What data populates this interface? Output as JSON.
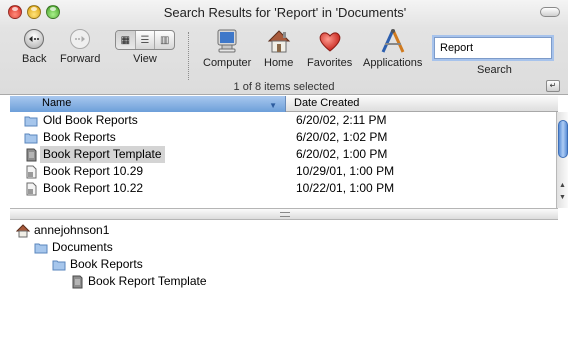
{
  "window": {
    "title": "Search Results for 'Report' in 'Documents'"
  },
  "toolbar": {
    "back_label": "Back",
    "forward_label": "Forward",
    "view_label": "View",
    "computer_label": "Computer",
    "home_label": "Home",
    "favorites_label": "Favorites",
    "applications_label": "Applications",
    "search_label": "Search",
    "search_value": "Report"
  },
  "status": {
    "text": "1 of 8 items selected"
  },
  "list": {
    "columns": {
      "name": "Name",
      "date": "Date Created"
    },
    "rows": [
      {
        "name": "Old Book Reports",
        "date": "6/20/02, 2:11 PM",
        "icon": "folder-icon",
        "selected": false
      },
      {
        "name": "Book Reports",
        "date": "6/20/02, 1:02 PM",
        "icon": "folder-icon",
        "selected": false
      },
      {
        "name": "Book Report Template",
        "date": "6/20/02, 1:00 PM",
        "icon": "stationery-icon",
        "selected": true
      },
      {
        "name": "Book Report 10.29",
        "date": "10/29/01, 1:00 PM",
        "icon": "document-icon",
        "selected": false
      },
      {
        "name": "Book Report 10.22",
        "date": "10/22/01, 1:00 PM",
        "icon": "document-icon",
        "selected": false
      }
    ]
  },
  "path": {
    "items": [
      {
        "label": "annejohnson1",
        "icon": "home-icon"
      },
      {
        "label": "Documents",
        "icon": "folder-icon"
      },
      {
        "label": "Book Reports",
        "icon": "folder-icon"
      },
      {
        "label": "Book Report Template",
        "icon": "stationery-icon"
      }
    ]
  },
  "colors": {
    "selection_header": "#6d9fd9",
    "selected_row": "#d4d4d4"
  }
}
